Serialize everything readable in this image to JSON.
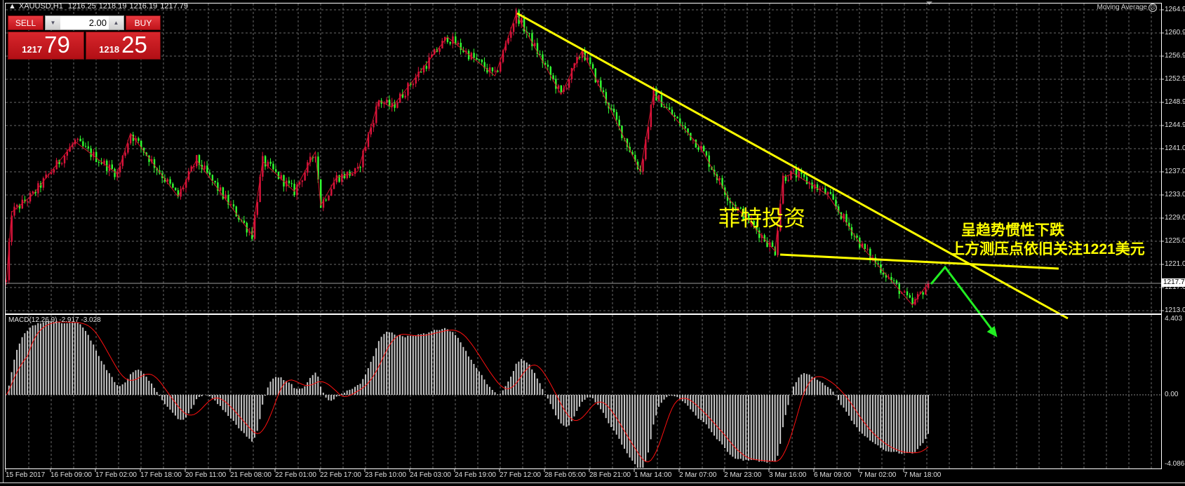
{
  "header": {
    "symbol": "XAUUSD,H1",
    "open": "1216.25",
    "high": "1218.19",
    "low": "1216.19",
    "close": "1217.79"
  },
  "trade_panel": {
    "sell_label": "SELL",
    "buy_label": "BUY",
    "lot": "2.00",
    "sell_price_small": "1217",
    "sell_price_large": "79",
    "buy_price_small": "1218",
    "buy_price_large": "25"
  },
  "indicator_label": "Moving Average",
  "price_axis": [
    "1264.9",
    "1260.9",
    "1256.9",
    "1252.9",
    "1248.9",
    "1244.9",
    "1241.0",
    "1237.0",
    "1233.0",
    "1229.0",
    "1225.0",
    "1221.0",
    "1217.0",
    "1213.0"
  ],
  "current_price": "1217.79",
  "macd": {
    "label": "MACD(12,26,9) -2.917 -3.028",
    "axis_max": "4.403",
    "axis_zero": "0.00",
    "axis_min": "-4.086"
  },
  "time_axis": [
    "15 Feb 2017",
    "16 Feb 09:00",
    "17 Feb 02:00",
    "17 Feb 18:00",
    "20 Feb 11:00",
    "21 Feb 08:00",
    "22 Feb 01:00",
    "22 Feb 17:00",
    "23 Feb 10:00",
    "24 Feb 03:00",
    "24 Feb 19:00",
    "27 Feb 12:00",
    "28 Feb 05:00",
    "28 Feb 21:00",
    "1 Mar 14:00",
    "2 Mar 07:00",
    "2 Mar 23:00",
    "3 Mar 16:00",
    "6 Mar 09:00",
    "7 Mar 02:00",
    "7 Mar 18:00"
  ],
  "annotations": {
    "watermark": "菲特投资",
    "line1": "呈趋势惯性下跌",
    "line2": "上方测压点依旧关注1221美元"
  },
  "colors": {
    "up": "#dc143c",
    "down": "#32ff32",
    "zigzag": "#d0102c",
    "trendline": "#ffff00",
    "arrow": "#22ee22",
    "macd_hist": "#c8c8c8",
    "macd_signal": "#ff1010",
    "grid": "#6a6a6a"
  },
  "chart_data": {
    "type": "candlestick",
    "symbol": "XAUUSD",
    "timeframe": "H1",
    "candle_count": 350,
    "ylim": [
      1209.2,
      1266.0
    ],
    "key_points": [
      [
        0,
        1218
      ],
      [
        2,
        1230
      ],
      [
        10,
        1233
      ],
      [
        26,
        1242.2
      ],
      [
        42,
        1236.6
      ],
      [
        47,
        1243.6
      ],
      [
        65,
        1232.7
      ],
      [
        72,
        1239
      ],
      [
        93,
        1226.1
      ],
      [
        97,
        1238.8
      ],
      [
        109,
        1233.6
      ],
      [
        117,
        1240.4
      ],
      [
        119,
        1231.2
      ],
      [
        125,
        1236
      ],
      [
        133,
        1237
      ],
      [
        141,
        1249.3
      ],
      [
        146,
        1248.1
      ],
      [
        167,
        1260.2
      ],
      [
        185,
        1253.5
      ],
      [
        193,
        1264.2
      ],
      [
        210,
        1250.3
      ],
      [
        218,
        1257.9
      ],
      [
        240,
        1237
      ],
      [
        245,
        1250.5
      ],
      [
        253,
        1246.3
      ],
      [
        263,
        1241
      ],
      [
        274,
        1232
      ],
      [
        282,
        1228
      ],
      [
        291,
        1223.3
      ],
      [
        294,
        1236
      ],
      [
        298,
        1236.7
      ],
      [
        311,
        1233
      ],
      [
        324,
        1224
      ],
      [
        343,
        1214
      ],
      [
        349,
        1217.79
      ]
    ],
    "trendlines": [
      {
        "from": [
          193,
          1264.5
        ],
        "to": "down-right",
        "label": "resistance"
      },
      {
        "from": [
          291,
          1222.5
        ],
        "label": "support ~1221"
      }
    ],
    "indicator": "MACD(12,26,9)",
    "macd_last": -2.917,
    "signal_last": -3.028
  }
}
